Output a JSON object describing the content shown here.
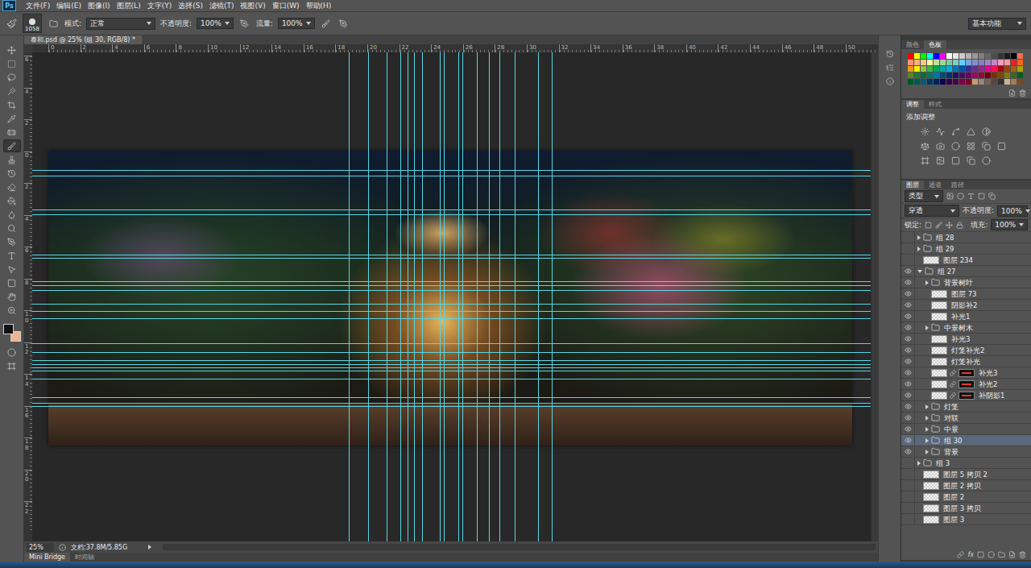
{
  "app": {
    "logo": "Ps"
  },
  "menu": [
    "文件(F)",
    "编辑(E)",
    "图像(I)",
    "图层(L)",
    "文字(Y)",
    "选择(S)",
    "滤镜(T)",
    "视图(V)",
    "窗口(W)",
    "帮助(H)"
  ],
  "options_bar": {
    "brush_size": "1058",
    "mode_label": "模式:",
    "mode": "正常",
    "opacity_label": "不透明度:",
    "opacity": "100%",
    "flow_label": "流量:",
    "flow": "100%",
    "workspace": "基本功能"
  },
  "tools": [
    {
      "kind": "move",
      "selected": false
    },
    {
      "kind": "marquee",
      "selected": false
    },
    {
      "kind": "lasso",
      "selected": false
    },
    {
      "kind": "wand",
      "selected": false
    },
    {
      "kind": "crop",
      "selected": false
    },
    {
      "kind": "eyedropper",
      "selected": false
    },
    {
      "kind": "heal",
      "selected": false
    },
    {
      "kind": "brush",
      "selected": true
    },
    {
      "kind": "stamp",
      "selected": false
    },
    {
      "kind": "history",
      "selected": false
    },
    {
      "kind": "eraser",
      "selected": false
    },
    {
      "kind": "bucket",
      "selected": false
    },
    {
      "kind": "blur",
      "selected": false
    },
    {
      "kind": "dodge",
      "selected": false
    },
    {
      "kind": "pen",
      "selected": false
    },
    {
      "kind": "type",
      "selected": false
    },
    {
      "kind": "select",
      "selected": false
    },
    {
      "kind": "shape",
      "selected": false
    },
    {
      "kind": "hand",
      "selected": false
    },
    {
      "kind": "zoom",
      "selected": false
    }
  ],
  "colors": {
    "foreground": "#111111",
    "background": "#f0b48c"
  },
  "document": {
    "tab": "泰和.psd @ 25% (组 30, RGB/8) *",
    "zoom": "25%",
    "doc_info": "文档:37.8M/5.85G"
  },
  "rulers": {
    "top": [
      "0",
      "2",
      "4",
      "6",
      "8",
      "10",
      "12",
      "14",
      "16",
      "18",
      "20",
      "22",
      "24",
      "26",
      "28",
      "30",
      "32",
      "34",
      "36",
      "38",
      "40",
      "42",
      "44",
      "46",
      "48",
      "50"
    ],
    "left": [
      "6",
      "4",
      "2",
      "0",
      "2",
      "4",
      "6",
      "8",
      "10",
      "12",
      "14",
      "16",
      "18",
      "20",
      "22"
    ]
  },
  "bottom_tabs": [
    {
      "label": "Mini Bridge",
      "selected": true
    },
    {
      "label": "时间轴",
      "selected": false
    }
  ],
  "color_panel": {
    "tabs": [
      {
        "label": "颜色",
        "selected": false
      },
      {
        "label": "色板",
        "selected": true
      }
    ],
    "swatches": [
      "#ff0000",
      "#ffff00",
      "#00ff00",
      "#00ffff",
      "#0000ff",
      "#ff00ff",
      "#ffffff",
      "#e6e6e6",
      "#cccccc",
      "#b3b3b3",
      "#999999",
      "#808080",
      "#666666",
      "#4d4d4d",
      "#333333",
      "#1a1a1a",
      "#000000",
      "#f26c4f",
      "#f7977a",
      "#fbad82",
      "#fdc68c",
      "#fff799",
      "#c6df9c",
      "#a4d49d",
      "#81ca9d",
      "#7bcdc9",
      "#6ccff7",
      "#7ca6d8",
      "#8293ca",
      "#8881be",
      "#a286bd",
      "#bc8cbf",
      "#f49bc1",
      "#f5999d",
      "#ee1c24",
      "#f26522",
      "#f7941d",
      "#fff200",
      "#8dc63f",
      "#39b54a",
      "#00a651",
      "#00a99d",
      "#00aeef",
      "#0072bc",
      "#0054a6",
      "#2e3192",
      "#662d91",
      "#92278f",
      "#ec008c",
      "#ed145b",
      "#9e0b0f",
      "#a0410d",
      "#a36209",
      "#aba000",
      "#598527",
      "#1a7b30",
      "#007236",
      "#00746b",
      "#0076a3",
      "#004b80",
      "#003471",
      "#1b1464",
      "#440e62",
      "#630460",
      "#9e005d",
      "#9e0039",
      "#790000",
      "#7b2e00",
      "#7d4900",
      "#827b00",
      "#406618",
      "#005e20",
      "#005826",
      "#005952",
      "#005b7f",
      "#003663",
      "#002157",
      "#0d004c",
      "#32004b",
      "#4b0049",
      "#7b0046",
      "#7a0026",
      "#c69c6d",
      "#998675",
      "#736357",
      "#534741",
      "#37302a",
      "#c7b299",
      "#a67c52",
      "#754c24"
    ]
  },
  "adjust_panel": {
    "tabs": [
      {
        "label": "调整",
        "selected": true
      },
      {
        "label": "样式",
        "selected": false
      }
    ],
    "title": "添加调整"
  },
  "layers_panel": {
    "tabs": [
      {
        "label": "图层",
        "selected": true
      },
      {
        "label": "通道",
        "selected": false
      },
      {
        "label": "路径",
        "selected": false
      }
    ],
    "filter": "类型",
    "blend": "穿透",
    "opacity_label": "不透明度:",
    "opacity": "100%",
    "lock_label": "锁定:",
    "fill_label": "填充:",
    "fill": "100%",
    "fx_label": "fx",
    "layers": [
      {
        "name": "组 28",
        "kind": "group",
        "visible": false,
        "expanded": false,
        "depth": 0,
        "selected": false,
        "masked": false
      },
      {
        "name": "组 29",
        "kind": "group",
        "visible": false,
        "expanded": false,
        "depth": 0,
        "selected": false,
        "masked": false
      },
      {
        "name": "图层 234",
        "kind": "layer",
        "visible": false,
        "expanded": false,
        "depth": 0,
        "selected": false,
        "masked": false
      },
      {
        "name": "组 27",
        "kind": "group",
        "visible": true,
        "expanded": true,
        "depth": 0,
        "selected": false,
        "masked": false
      },
      {
        "name": "背景树叶",
        "kind": "group",
        "visible": true,
        "expanded": false,
        "depth": 1,
        "selected": false,
        "masked": false
      },
      {
        "name": "图层 73",
        "kind": "layer",
        "visible": true,
        "expanded": false,
        "depth": 1,
        "selected": false,
        "masked": false
      },
      {
        "name": "阴影补2",
        "kind": "layer",
        "visible": true,
        "expanded": false,
        "depth": 1,
        "selected": false,
        "masked": false
      },
      {
        "name": "补光1",
        "kind": "layer",
        "visible": true,
        "expanded": false,
        "depth": 1,
        "selected": false,
        "masked": false
      },
      {
        "name": "中景树木",
        "kind": "group",
        "visible": true,
        "expanded": false,
        "depth": 1,
        "selected": false,
        "masked": false
      },
      {
        "name": "补光3",
        "kind": "layer",
        "visible": true,
        "expanded": false,
        "depth": 1,
        "selected": false,
        "masked": false
      },
      {
        "name": "灯笼补光2",
        "kind": "layer",
        "visible": true,
        "expanded": false,
        "depth": 1,
        "selected": false,
        "masked": false
      },
      {
        "name": "灯笼补光",
        "kind": "layer",
        "visible": true,
        "expanded": false,
        "depth": 1,
        "selected": false,
        "masked": false
      },
      {
        "name": "补光3",
        "kind": "layer",
        "visible": true,
        "expanded": false,
        "depth": 1,
        "selected": false,
        "masked": true
      },
      {
        "name": "补光2",
        "kind": "layer",
        "visible": true,
        "expanded": false,
        "depth": 1,
        "selected": false,
        "masked": true
      },
      {
        "name": "补阴影1",
        "kind": "layer",
        "visible": true,
        "expanded": false,
        "depth": 1,
        "selected": false,
        "masked": true
      },
      {
        "name": "灯笼",
        "kind": "group",
        "visible": true,
        "expanded": false,
        "depth": 1,
        "selected": false,
        "masked": false
      },
      {
        "name": "对联",
        "kind": "group",
        "visible": true,
        "expanded": false,
        "depth": 1,
        "selected": false,
        "masked": false
      },
      {
        "name": "中景",
        "kind": "group",
        "visible": true,
        "expanded": false,
        "depth": 1,
        "selected": false,
        "masked": false
      },
      {
        "name": "组 30",
        "kind": "group",
        "visible": true,
        "expanded": false,
        "depth": 1,
        "selected": true,
        "masked": false
      },
      {
        "name": "背景",
        "kind": "group",
        "visible": true,
        "expanded": false,
        "depth": 1,
        "selected": false,
        "masked": false
      },
      {
        "name": "组 3",
        "kind": "group",
        "visible": false,
        "expanded": false,
        "depth": 0,
        "selected": false,
        "masked": false
      },
      {
        "name": "图层 5 拷贝 2",
        "kind": "layer",
        "visible": false,
        "expanded": false,
        "depth": 0,
        "selected": false,
        "masked": false
      },
      {
        "name": "图层 2 拷贝",
        "kind": "layer",
        "visible": false,
        "expanded": false,
        "depth": 0,
        "selected": false,
        "masked": false
      },
      {
        "name": "图层 2",
        "kind": "layer",
        "visible": false,
        "expanded": false,
        "depth": 0,
        "selected": false,
        "masked": false
      },
      {
        "name": "图层 3 拷贝",
        "kind": "layer",
        "visible": false,
        "expanded": false,
        "depth": 0,
        "selected": false,
        "masked": false
      },
      {
        "name": "图层 3",
        "kind": "layer",
        "visible": false,
        "expanded": false,
        "depth": 0,
        "selected": false,
        "masked": false
      }
    ]
  }
}
